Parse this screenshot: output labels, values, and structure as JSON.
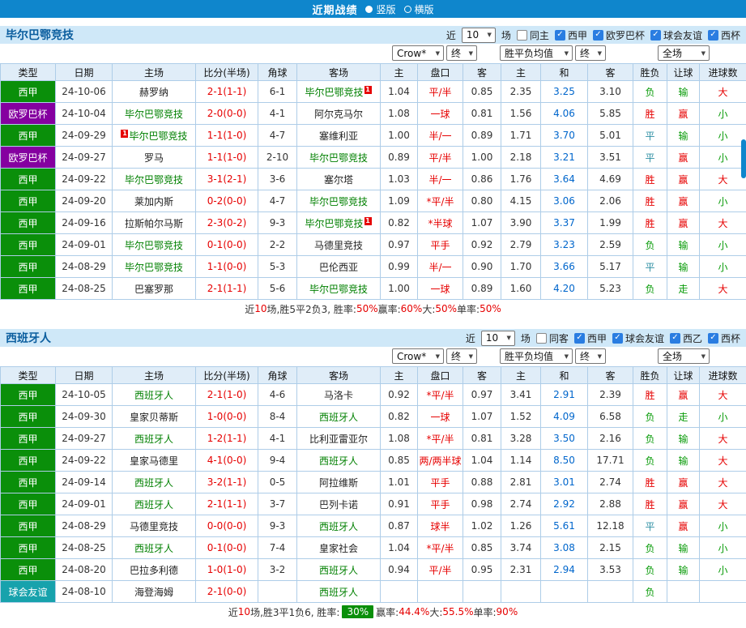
{
  "topbar": {
    "title": "近期战绩",
    "radio_vertical": "竖版",
    "radio_horizontal": "横版"
  },
  "colors": {
    "topbar": "#0f86cc",
    "header_bg": "#cfe8f8",
    "header_text": "#0a5d9e",
    "border": "#aecde8",
    "thead_bg": "#e0edf8",
    "league": {
      "西甲": "#0a8f0a",
      "欧罗巴杯": "#8500a0",
      "球会友谊": "#17a2ac"
    },
    "focal_team": "#008000",
    "score": "#e60000",
    "win": "#e60000",
    "draw": "#2e8fa3",
    "lose": "#089b08",
    "avg_mid": "#0066cc",
    "badge_bg": "#0a8f0a",
    "checkbox": "#2a7de1"
  },
  "sections": [
    {
      "team": "毕尔巴鄂竞技",
      "filter": {
        "near": "近",
        "count": "10",
        "suffix": "场",
        "checkboxes": [
          {
            "label": "同主",
            "checked": false
          },
          {
            "label": "西甲",
            "checked": true
          },
          {
            "label": "欧罗巴杯",
            "checked": true
          },
          {
            "label": "球会友谊",
            "checked": true
          },
          {
            "label": "西杯",
            "checked": true
          }
        ]
      },
      "selects": [
        "Crow*",
        "终",
        "胜平负均值",
        "终",
        "全场"
      ],
      "columns": [
        "类型",
        "日期",
        "主场",
        "比分(半场)",
        "角球",
        "客场",
        "主",
        "盘口",
        "客",
        "主",
        "和",
        "客",
        "胜负",
        "让球",
        "进球数"
      ],
      "rows": [
        {
          "league": "西甲",
          "date": "24-10-06",
          "home": "赫罗纳",
          "home_focal": false,
          "away": "毕尔巴鄂竞技",
          "away_focal": true,
          "away_card": "1",
          "away_card_pos": "right",
          "score": "2-1(1-1)",
          "corners": "6-1",
          "o1": "1.04",
          "hc": "平/半",
          "o2": "0.85",
          "a1": "2.35",
          "a2": "3.25",
          "a3": "3.10",
          "res": "负",
          "hres": "输",
          "goals": "大"
        },
        {
          "league": "欧罗巴杯",
          "date": "24-10-04",
          "home": "毕尔巴鄂竞技",
          "home_focal": true,
          "away": "阿尔克马尔",
          "away_focal": false,
          "score": "2-0(0-0)",
          "corners": "4-1",
          "o1": "1.08",
          "hc": "一球",
          "o2": "0.81",
          "a1": "1.56",
          "a2": "4.06",
          "a3": "5.85",
          "res": "胜",
          "hres": "赢",
          "goals": "小"
        },
        {
          "league": "西甲",
          "date": "24-09-29",
          "home": "毕尔巴鄂竞技",
          "home_focal": true,
          "home_card": "1",
          "home_card_pos": "left",
          "away": "塞维利亚",
          "away_focal": false,
          "score": "1-1(1-0)",
          "corners": "4-7",
          "o1": "1.00",
          "hc": "半/一",
          "o2": "0.89",
          "a1": "1.71",
          "a2": "3.70",
          "a3": "5.01",
          "res": "平",
          "hres": "输",
          "goals": "小"
        },
        {
          "league": "欧罗巴杯",
          "date": "24-09-27",
          "home": "罗马",
          "home_focal": false,
          "away": "毕尔巴鄂竞技",
          "away_focal": true,
          "score": "1-1(1-0)",
          "corners": "2-10",
          "o1": "0.89",
          "hc": "平/半",
          "o2": "1.00",
          "a1": "2.18",
          "a2": "3.21",
          "a3": "3.51",
          "res": "平",
          "hres": "赢",
          "goals": "小"
        },
        {
          "league": "西甲",
          "date": "24-09-22",
          "home": "毕尔巴鄂竞技",
          "home_focal": true,
          "away": "塞尔塔",
          "away_focal": false,
          "score": "3-1(2-1)",
          "corners": "3-6",
          "o1": "1.03",
          "hc": "半/一",
          "o2": "0.86",
          "a1": "1.76",
          "a2": "3.64",
          "a3": "4.69",
          "res": "胜",
          "hres": "赢",
          "goals": "大"
        },
        {
          "league": "西甲",
          "date": "24-09-20",
          "home": "莱加内斯",
          "home_focal": false,
          "away": "毕尔巴鄂竞技",
          "away_focal": true,
          "score": "0-2(0-0)",
          "corners": "4-7",
          "o1": "1.09",
          "hc": "*平/半",
          "o2": "0.80",
          "a1": "4.15",
          "a2": "3.06",
          "a3": "2.06",
          "res": "胜",
          "hres": "赢",
          "goals": "小"
        },
        {
          "league": "西甲",
          "date": "24-09-16",
          "home": "拉斯帕尔马斯",
          "home_focal": false,
          "away": "毕尔巴鄂竞技",
          "away_focal": true,
          "away_card": "1",
          "away_card_pos": "right",
          "score": "2-3(0-2)",
          "corners": "9-3",
          "o1": "0.82",
          "hc": "*半球",
          "o2": "1.07",
          "a1": "3.90",
          "a2": "3.37",
          "a3": "1.99",
          "res": "胜",
          "hres": "赢",
          "goals": "大"
        },
        {
          "league": "西甲",
          "date": "24-09-01",
          "home": "毕尔巴鄂竞技",
          "home_focal": true,
          "away": "马德里竞技",
          "away_focal": false,
          "score": "0-1(0-0)",
          "corners": "2-2",
          "o1": "0.97",
          "hc": "平手",
          "o2": "0.92",
          "a1": "2.79",
          "a2": "3.23",
          "a3": "2.59",
          "res": "负",
          "hres": "输",
          "goals": "小"
        },
        {
          "league": "西甲",
          "date": "24-08-29",
          "home": "毕尔巴鄂竞技",
          "home_focal": true,
          "away": "巴伦西亚",
          "away_focal": false,
          "score": "1-1(0-0)",
          "corners": "5-3",
          "o1": "0.99",
          "hc": "半/一",
          "o2": "0.90",
          "a1": "1.70",
          "a2": "3.66",
          "a3": "5.17",
          "res": "平",
          "hres": "输",
          "goals": "小"
        },
        {
          "league": "西甲",
          "date": "24-08-25",
          "home": "巴塞罗那",
          "home_focal": false,
          "away": "毕尔巴鄂竞技",
          "away_focal": true,
          "score": "2-1(1-1)",
          "corners": "5-6",
          "o1": "1.00",
          "hc": "一球",
          "o2": "0.89",
          "a1": "1.60",
          "a2": "4.20",
          "a3": "5.23",
          "res": "负",
          "hres": "走",
          "goals": "大"
        }
      ],
      "summary": [
        {
          "t": "近",
          "c": "text"
        },
        {
          "t": "10",
          "c": "red"
        },
        {
          "t": "场,胜5平2负3, 胜率: ",
          "c": "text"
        },
        {
          "t": "50%",
          "c": "red"
        },
        {
          "t": " 赢率: ",
          "c": "text"
        },
        {
          "t": "60%",
          "c": "red"
        },
        {
          "t": " 大: ",
          "c": "text"
        },
        {
          "t": "50%",
          "c": "red"
        },
        {
          "t": " 单率: ",
          "c": "text"
        },
        {
          "t": "50%",
          "c": "red"
        }
      ]
    },
    {
      "team": "西班牙人",
      "filter": {
        "near": "近",
        "count": "10",
        "suffix": "场",
        "checkboxes": [
          {
            "label": "同客",
            "checked": false
          },
          {
            "label": "西甲",
            "checked": true
          },
          {
            "label": "球会友谊",
            "checked": true
          },
          {
            "label": "西乙",
            "checked": true
          },
          {
            "label": "西杯",
            "checked": true
          }
        ]
      },
      "selects": [
        "Crow*",
        "终",
        "胜平负均值",
        "终",
        "全场"
      ],
      "columns": [
        "类型",
        "日期",
        "主场",
        "比分(半场)",
        "角球",
        "客场",
        "主",
        "盘口",
        "客",
        "主",
        "和",
        "客",
        "胜负",
        "让球",
        "进球数"
      ],
      "rows": [
        {
          "league": "西甲",
          "date": "24-10-05",
          "home": "西班牙人",
          "home_focal": true,
          "away": "马洛卡",
          "away_focal": false,
          "score": "2-1(1-0)",
          "corners": "4-6",
          "o1": "0.92",
          "hc": "*平/半",
          "o2": "0.97",
          "a1": "3.41",
          "a2": "2.91",
          "a3": "2.39",
          "res": "胜",
          "hres": "赢",
          "goals": "大"
        },
        {
          "league": "西甲",
          "date": "24-09-30",
          "home": "皇家贝蒂斯",
          "home_focal": false,
          "away": "西班牙人",
          "away_focal": true,
          "score": "1-0(0-0)",
          "corners": "8-4",
          "o1": "0.82",
          "hc": "一球",
          "o2": "1.07",
          "a1": "1.52",
          "a2": "4.09",
          "a3": "6.58",
          "res": "负",
          "hres": "走",
          "goals": "小"
        },
        {
          "league": "西甲",
          "date": "24-09-27",
          "home": "西班牙人",
          "home_focal": true,
          "away": "比利亚雷亚尔",
          "away_focal": false,
          "score": "1-2(1-1)",
          "corners": "4-1",
          "o1": "1.08",
          "hc": "*平/半",
          "o2": "0.81",
          "a1": "3.28",
          "a2": "3.50",
          "a3": "2.16",
          "res": "负",
          "hres": "输",
          "goals": "大"
        },
        {
          "league": "西甲",
          "date": "24-09-22",
          "home": "皇家马德里",
          "home_focal": false,
          "away": "西班牙人",
          "away_focal": true,
          "score": "4-1(0-0)",
          "corners": "9-4",
          "o1": "0.85",
          "hc": "两/两半球",
          "o2": "1.04",
          "a1": "1.14",
          "a2": "8.50",
          "a3": "17.71",
          "res": "负",
          "hres": "输",
          "goals": "大"
        },
        {
          "league": "西甲",
          "date": "24-09-14",
          "home": "西班牙人",
          "home_focal": true,
          "away": "阿拉维斯",
          "away_focal": false,
          "score": "3-2(1-1)",
          "corners": "0-5",
          "o1": "1.01",
          "hc": "平手",
          "o2": "0.88",
          "a1": "2.81",
          "a2": "3.01",
          "a3": "2.74",
          "res": "胜",
          "hres": "赢",
          "goals": "大"
        },
        {
          "league": "西甲",
          "date": "24-09-01",
          "home": "西班牙人",
          "home_focal": true,
          "away": "巴列卡诺",
          "away_focal": false,
          "score": "2-1(1-1)",
          "corners": "3-7",
          "o1": "0.91",
          "hc": "平手",
          "o2": "0.98",
          "a1": "2.74",
          "a2": "2.92",
          "a3": "2.88",
          "res": "胜",
          "hres": "赢",
          "goals": "大"
        },
        {
          "league": "西甲",
          "date": "24-08-29",
          "home": "马德里竞技",
          "home_focal": false,
          "away": "西班牙人",
          "away_focal": true,
          "score": "0-0(0-0)",
          "corners": "9-3",
          "o1": "0.87",
          "hc": "球半",
          "o2": "1.02",
          "a1": "1.26",
          "a2": "5.61",
          "a3": "12.18",
          "res": "平",
          "hres": "赢",
          "goals": "小"
        },
        {
          "league": "西甲",
          "date": "24-08-25",
          "home": "西班牙人",
          "home_focal": true,
          "away": "皇家社会",
          "away_focal": false,
          "score": "0-1(0-0)",
          "corners": "7-4",
          "o1": "1.04",
          "hc": "*平/半",
          "o2": "0.85",
          "a1": "3.74",
          "a2": "3.08",
          "a3": "2.15",
          "res": "负",
          "hres": "输",
          "goals": "小"
        },
        {
          "league": "西甲",
          "date": "24-08-20",
          "home": "巴拉多利德",
          "home_focal": false,
          "away": "西班牙人",
          "away_focal": true,
          "score": "1-0(1-0)",
          "corners": "3-2",
          "o1": "0.94",
          "hc": "平/半",
          "o2": "0.95",
          "a1": "2.31",
          "a2": "2.94",
          "a3": "3.53",
          "res": "负",
          "hres": "输",
          "goals": "小"
        },
        {
          "league": "球会友谊",
          "date": "24-08-10",
          "home": "海登海姆",
          "home_focal": false,
          "away": "西班牙人",
          "away_focal": true,
          "score": "2-1(0-0)",
          "corners": "",
          "o1": "",
          "hc": "",
          "o2": "",
          "a1": "",
          "a2": "",
          "a3": "",
          "res": "负",
          "hres": "",
          "goals": ""
        }
      ],
      "summary": [
        {
          "t": "近",
          "c": "text"
        },
        {
          "t": "10",
          "c": "red"
        },
        {
          "t": "场,胜3平1负6, 胜率: ",
          "c": "text"
        },
        {
          "t": "30%",
          "c": "badge"
        },
        {
          "t": " 赢率:",
          "c": "text"
        },
        {
          "t": "44.4%",
          "c": "red"
        },
        {
          "t": " 大:",
          "c": "text"
        },
        {
          "t": "55.5%",
          "c": "red"
        },
        {
          "t": " 单率:",
          "c": "text"
        },
        {
          "t": "90%",
          "c": "red"
        }
      ]
    }
  ]
}
